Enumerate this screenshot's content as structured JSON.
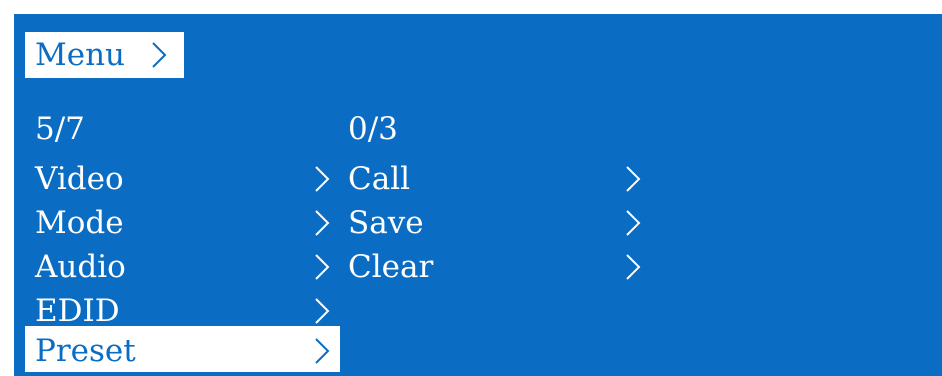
{
  "colors": {
    "screen_bg": "#0a6cc2",
    "text": "#ffffff",
    "highlight_bg": "#ffffff",
    "highlight_text": "#0a6cc2"
  },
  "header": {
    "title": "Menu",
    "arrow_icon": "chevron-right-icon"
  },
  "left_column": {
    "counter": "5/7",
    "items": [
      {
        "label": "Video",
        "icon": "chevron-right-icon"
      },
      {
        "label": "Mode",
        "icon": "chevron-right-icon"
      },
      {
        "label": "Audio",
        "icon": "chevron-right-icon"
      },
      {
        "label": "EDID",
        "icon": "chevron-right-icon"
      },
      {
        "label": "Preset",
        "icon": "chevron-right-icon",
        "selected": true
      }
    ]
  },
  "right_column": {
    "counter": "0/3",
    "items": [
      {
        "label": "Call",
        "icon": "chevron-right-icon"
      },
      {
        "label": "Save",
        "icon": "chevron-right-icon"
      },
      {
        "label": "Clear",
        "icon": "chevron-right-icon"
      }
    ]
  }
}
